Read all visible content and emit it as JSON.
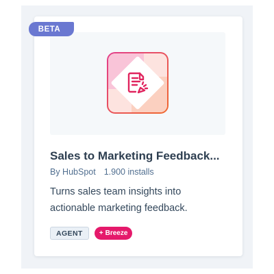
{
  "card": {
    "badge": "BETA",
    "title": "Sales to Marketing Feedback...",
    "author": "By HubSpot",
    "installs": "1.900 installs",
    "description": "Turns sales team insights into actionable marketing feedback.",
    "tags": {
      "agent": "AGENT",
      "breeze_prefix": "+",
      "breeze": "Breeze"
    },
    "icon": "document-feedback-icon"
  },
  "colors": {
    "badge_bg": "#6a78d1",
    "title": "#2d3e50",
    "breeze": "#e5196b",
    "icon_gradient_start": "#e23d8b",
    "icon_gradient_end": "#f0682c"
  }
}
